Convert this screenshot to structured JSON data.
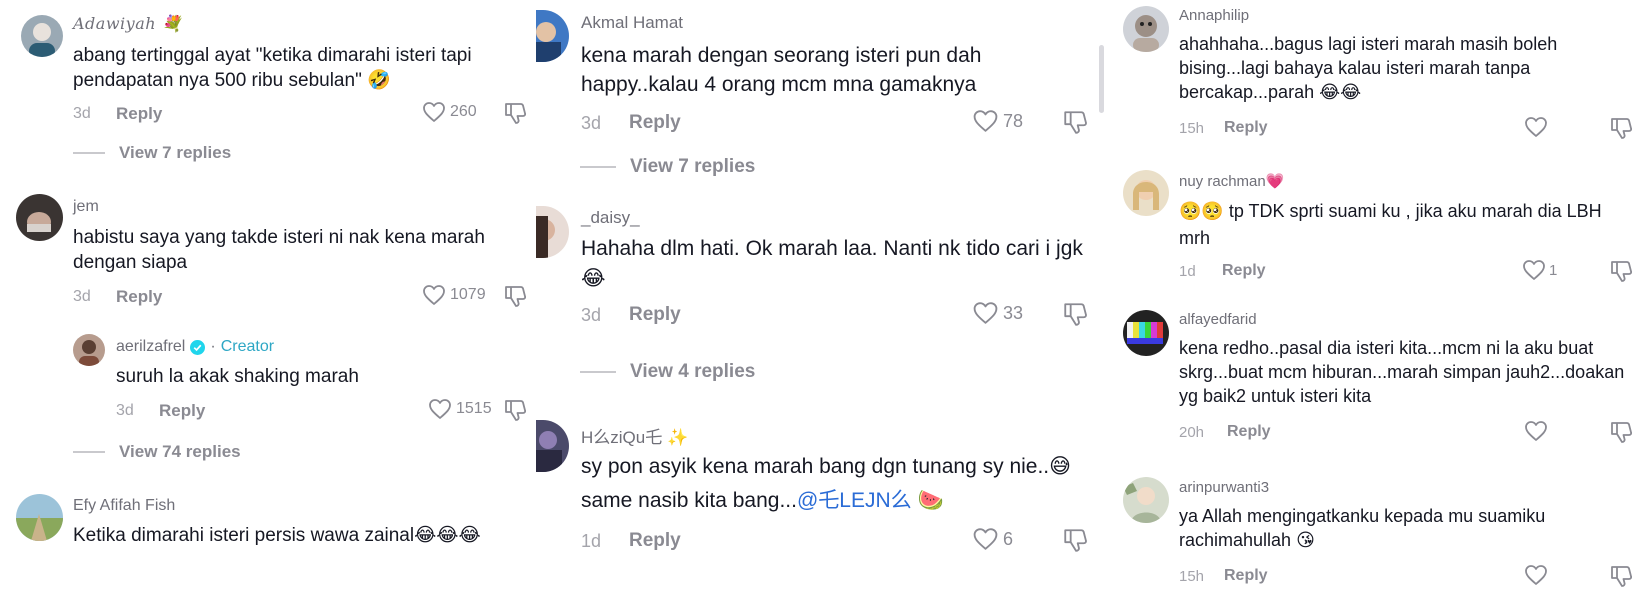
{
  "col1": {
    "c1": {
      "user": "Adawiyah",
      "text": "abang tertinggal ayat \"ketika dimarahi isteri tapi pendapatan nya 500 ribu sebulan\"",
      "emoji": "🤣",
      "time": "3d",
      "reply": "Reply",
      "likes": "260",
      "view": "View 7 replies"
    },
    "c2": {
      "user": "jem",
      "text": "habistu saya yang takde isteri ni nak kena marah dengan siapa",
      "time": "3d",
      "reply": "Reply",
      "likes": "1079"
    },
    "c3": {
      "user": "aerilzafrel",
      "badge": "Creator",
      "sep": "·",
      "text": "suruh la akak shaking marah",
      "time": "3d",
      "reply": "Reply",
      "likes": "1515",
      "view": "View 74 replies"
    },
    "c4": {
      "user": "Efy Afifah Fish",
      "text": "Ketika dimarahi isteri persis wawa zainal",
      "emoji": "😂😂😂"
    }
  },
  "col2": {
    "c1": {
      "user": "Akmal Hamat",
      "text": "kena marah dengan seorang isteri pun dah happy..kalau 4 orang mcm mna gamaknya",
      "time": "3d",
      "reply": "Reply",
      "likes": "78",
      "view": "View 7 replies"
    },
    "c2": {
      "user": "_daisy_",
      "text": "Hahaha dlm hati. Ok marah laa. Nanti nk tido cari i jgk",
      "emoji": "😂",
      "time": "3d",
      "reply": "Reply",
      "likes": "33",
      "view": "View 4 replies"
    },
    "c3": {
      "user": "H么ziQu乇",
      "user_emoji": "✨",
      "text_a": "sy pon asyik kena marah bang dgn tunang sy nie..",
      "emoji_a": "😅",
      "text_b": "same nasib kita bang...",
      "mention": "@乇LEJN么",
      "emoji_b": "🍉",
      "time": "1d",
      "reply": "Reply",
      "likes": "6"
    }
  },
  "col3": {
    "c1": {
      "user": "Annaphilip",
      "text": "ahahhaha...bagus lagi isteri marah masih boleh bising...lagi bahaya kalau isteri marah tanpa bercakap...parah",
      "emoji": "😂😂",
      "time": "15h",
      "reply": "Reply"
    },
    "c2": {
      "user": "nuy rachman",
      "user_emoji": "💗",
      "emoji": "🥺🥺",
      "text": "tp TDK sprti suami ku , jika aku marah dia LBH mrh",
      "time": "1d",
      "reply": "Reply",
      "likes": "1"
    },
    "c3": {
      "user": "alfayedfarid",
      "text": "kena redho..pasal dia isteri kita...mcm ni la aku buat skrg...buat mcm hiburan...marah simpan jauh2...doakan yg baik2 untuk isteri kita",
      "time": "20h",
      "reply": "Reply"
    },
    "c4": {
      "user": "arinpurwanti3",
      "text": "ya Allah mengingatkanku kepada mu suamiku rachimahullah",
      "emoji": "😘",
      "time": "15h",
      "reply": "Reply"
    }
  },
  "colors": {
    "creator": "#2ea7c5",
    "mention": "#2b6cd6",
    "meta": "#a4a4ab",
    "username": "#6f6f78"
  },
  "icons": [
    "heart-outline-icon",
    "thumbs-down-icon",
    "verified-badge-icon",
    "avatar"
  ]
}
